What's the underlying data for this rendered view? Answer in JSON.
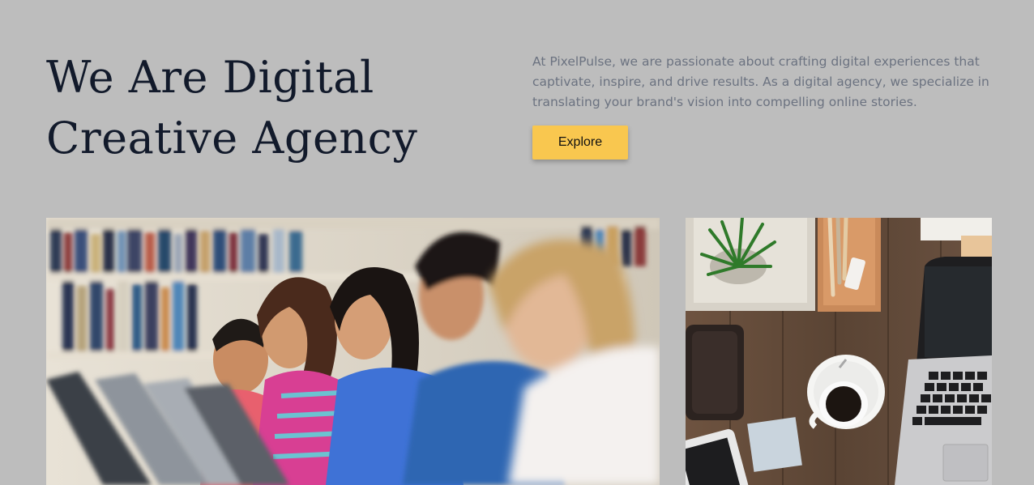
{
  "hero": {
    "title_line1": "We Are Digital",
    "title_line2": "Creative Agency",
    "description": "At PixelPulse, we are passionate about crafting digital experiences that captivate, inspire, and drive results. As a digital agency, we specialize in translating your brand's vision into compelling online stories.",
    "explore_label": "Explore"
  },
  "colors": {
    "background": "#bdbdbd",
    "title": "#121a2b",
    "text": "#6b7280",
    "accent": "#f9c74f"
  },
  "images": [
    {
      "name": "students-at-computers-photo"
    },
    {
      "name": "workspace-desk-photo"
    }
  ]
}
